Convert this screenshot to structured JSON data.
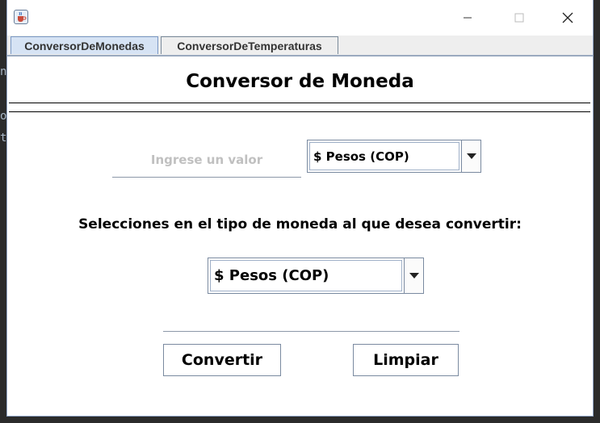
{
  "ide_fragment": {
    "lines": [
      "n",
      "o",
      "t"
    ]
  },
  "window": {
    "icon": "java-cup-icon",
    "controls": {
      "minimize_icon": "minimize-icon",
      "maximize_icon": "maximize-icon",
      "close_icon": "close-icon"
    }
  },
  "tabs": [
    {
      "label": "ConversorDeMonedas",
      "active": true
    },
    {
      "label": "ConversorDeTemperaturas",
      "active": false
    }
  ],
  "panel": {
    "title": "Conversor de Moneda",
    "amount_input": {
      "value": "",
      "placeholder": "Ingrese un valor"
    },
    "from_currency": {
      "selected": "$ Pesos (COP)",
      "icon": "chevron-down-icon"
    },
    "target_label": "Selecciones en el tipo de moneda al que desea convertir:",
    "to_currency": {
      "selected": "$ Pesos (COP)",
      "icon": "chevron-down-icon"
    },
    "result": "",
    "buttons": {
      "convert": "Convertir",
      "clear": "Limpiar"
    }
  },
  "colors": {
    "tab_active_bg": "#d6e3f4",
    "placeholder": "#c0c0c0",
    "border": "#7a8aa0",
    "ide_background": "#2b2b2b"
  }
}
